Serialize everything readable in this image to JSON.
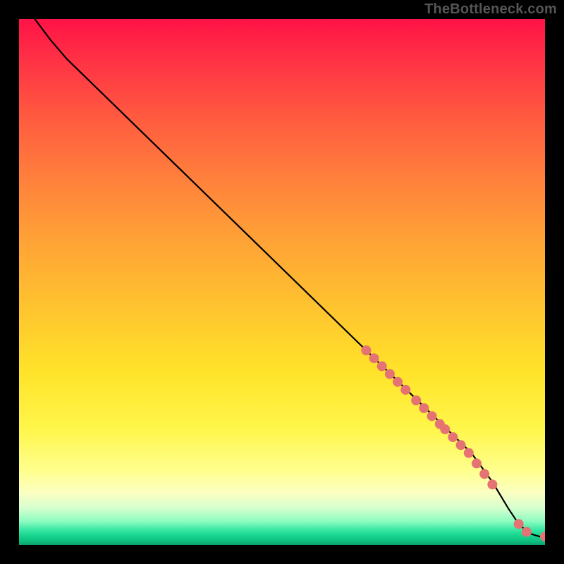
{
  "watermark": "TheBottleneck.com",
  "chart_data": {
    "type": "line",
    "title": "",
    "xlabel": "",
    "ylabel": "",
    "xlim": [
      0,
      100
    ],
    "ylim": [
      0,
      100
    ],
    "gradient_stops": [
      {
        "pos_pct": 0,
        "color": "#ff1347"
      },
      {
        "pos_pct": 7,
        "color": "#ff2e45"
      },
      {
        "pos_pct": 18,
        "color": "#ff5840"
      },
      {
        "pos_pct": 30,
        "color": "#ff7f3c"
      },
      {
        "pos_pct": 42,
        "color": "#ffa236"
      },
      {
        "pos_pct": 55,
        "color": "#ffc42f"
      },
      {
        "pos_pct": 67,
        "color": "#ffe329"
      },
      {
        "pos_pct": 78,
        "color": "#fff64b"
      },
      {
        "pos_pct": 86,
        "color": "#ffff8f"
      },
      {
        "pos_pct": 90,
        "color": "#fcffc1"
      },
      {
        "pos_pct": 93,
        "color": "#d6ffcf"
      },
      {
        "pos_pct": 95.5,
        "color": "#8dfcc0"
      },
      {
        "pos_pct": 97,
        "color": "#3de9a6"
      },
      {
        "pos_pct": 98.3,
        "color": "#15d38e"
      },
      {
        "pos_pct": 99.4,
        "color": "#0dbb7b"
      },
      {
        "pos_pct": 100,
        "color": "#0aa06a"
      }
    ],
    "curve": [
      {
        "x": 3,
        "y": 100
      },
      {
        "x": 6,
        "y": 96
      },
      {
        "x": 9,
        "y": 92.5
      },
      {
        "x": 66,
        "y": 37
      },
      {
        "x": 86,
        "y": 17.5
      },
      {
        "x": 90,
        "y": 12
      },
      {
        "x": 93,
        "y": 7
      },
      {
        "x": 95,
        "y": 4
      },
      {
        "x": 97,
        "y": 2.2
      },
      {
        "x": 99,
        "y": 1.6
      },
      {
        "x": 100,
        "y": 1.6
      }
    ],
    "markers": {
      "color": "#e57373",
      "radius_px": 7,
      "points": [
        {
          "x": 66,
          "y": 37
        },
        {
          "x": 67.5,
          "y": 35.5
        },
        {
          "x": 69,
          "y": 34
        },
        {
          "x": 70.5,
          "y": 32.5
        },
        {
          "x": 72,
          "y": 31
        },
        {
          "x": 73.5,
          "y": 29.5
        },
        {
          "x": 75.5,
          "y": 27.5
        },
        {
          "x": 77,
          "y": 26
        },
        {
          "x": 78.5,
          "y": 24.5
        },
        {
          "x": 80,
          "y": 23
        },
        {
          "x": 81,
          "y": 22
        },
        {
          "x": 82.5,
          "y": 20.5
        },
        {
          "x": 84,
          "y": 19
        },
        {
          "x": 85.5,
          "y": 17.5
        },
        {
          "x": 87,
          "y": 15.5
        },
        {
          "x": 88.5,
          "y": 13.5
        },
        {
          "x": 90,
          "y": 11.5
        },
        {
          "x": 95,
          "y": 4
        },
        {
          "x": 96.5,
          "y": 2.5
        },
        {
          "x": 100,
          "y": 1.6
        }
      ]
    }
  }
}
